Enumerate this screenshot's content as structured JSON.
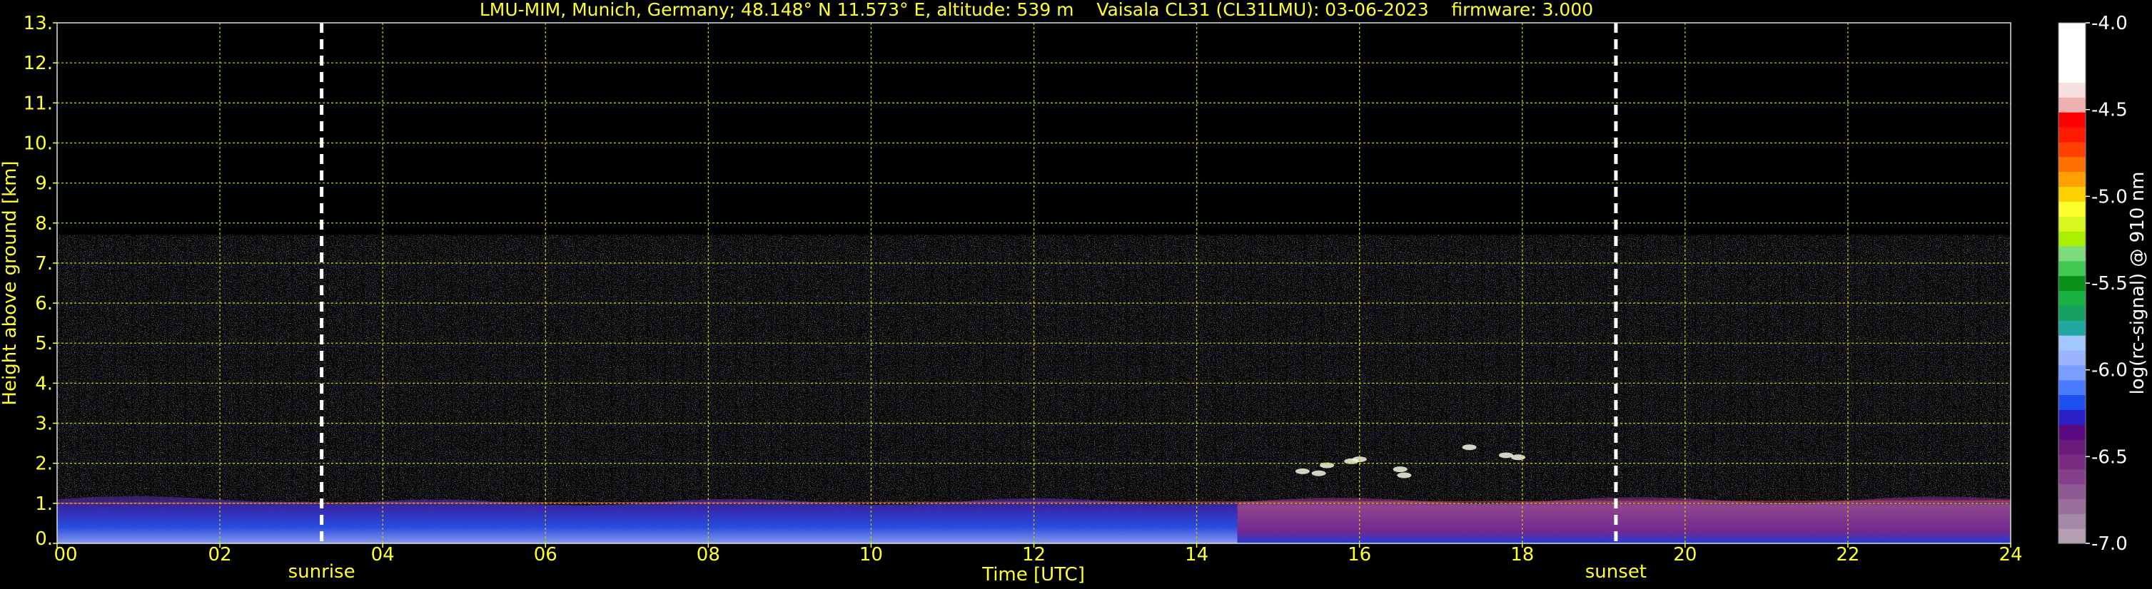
{
  "chart_data": {
    "type": "heatmap",
    "title": "LMU-MIM, Munich, Germany; 48.148° N 11.573° E, altitude: 539 m    Vaisala CL31 (CL31LMU): 03-06-2023    firmware: 3.000",
    "xlabel": "Time [UTC]",
    "ylabel": "Height above ground [km]",
    "xlim": [
      0,
      24
    ],
    "ylim": [
      0,
      13
    ],
    "x_ticks": [
      "00",
      "02",
      "04",
      "06",
      "08",
      "10",
      "12",
      "14",
      "16",
      "18",
      "20",
      "22",
      "24"
    ],
    "x_tick_values": [
      0,
      2,
      4,
      6,
      8,
      10,
      12,
      14,
      16,
      18,
      20,
      22,
      24
    ],
    "y_ticks": [
      "0.",
      "1.",
      "2.",
      "3.",
      "4.",
      "5.",
      "6.",
      "7.",
      "8.",
      "9.",
      "10.",
      "11.",
      "12.",
      "13."
    ],
    "y_tick_values": [
      0,
      1,
      2,
      3,
      4,
      5,
      6,
      7,
      8,
      9,
      10,
      11,
      12,
      13
    ],
    "grid": true,
    "data_top_km": 7.7,
    "markers": [
      {
        "label": "sunrise",
        "time": 3.25
      },
      {
        "label": "sunset",
        "time": 19.15
      }
    ],
    "colorbar": {
      "label": "log(rc-signal) @ 910 nm",
      "range": [
        -7.0,
        -4.0
      ],
      "ticks": [
        "-4.0",
        "-4.5",
        "-5.0",
        "-5.5",
        "-6.0",
        "-6.5",
        "-7.0"
      ],
      "tick_values": [
        -4.0,
        -4.5,
        -5.0,
        -5.5,
        -6.0,
        -6.5,
        -7.0
      ],
      "colors": [
        "#b4a0b0",
        "#a58aa8",
        "#9a6f9c",
        "#8e5893",
        "#84408a",
        "#7a2c82",
        "#6a1a7a",
        "#5a0a80",
        "#2a20c8",
        "#1e50f0",
        "#4a7cff",
        "#7a9eff",
        "#9ab4ff",
        "#a0c8ff",
        "#20a8a0",
        "#16a060",
        "#18b040",
        "#0a9018",
        "#40c850",
        "#7cdc7c",
        "#a8f000",
        "#d8f820",
        "#ffff30",
        "#ffd000",
        "#ffa000",
        "#ff7000",
        "#ff4000",
        "#ff1a00",
        "#ff0000",
        "#f0b0b0",
        "#f8e0e0",
        "#ffffff",
        "#ffffff",
        "#ffffff",
        "#ffffff"
      ]
    },
    "layers": [
      {
        "name": "boundary layer",
        "start": 0,
        "end": 24,
        "top_km_start": 1.0,
        "top_km_end": 1.1
      }
    ]
  }
}
